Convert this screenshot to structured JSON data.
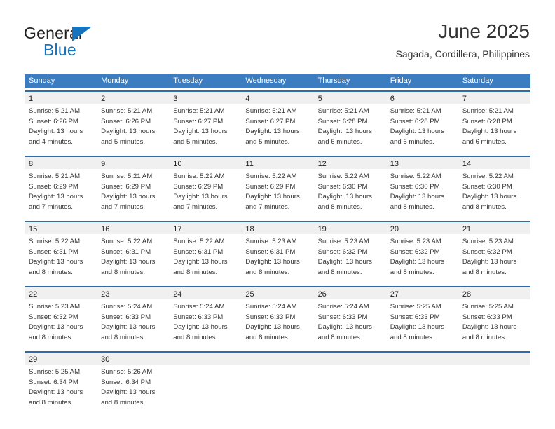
{
  "brand": {
    "name_top": "General",
    "name_bottom": "Blue",
    "accent_color": "#1574bd"
  },
  "header": {
    "title": "June 2025",
    "subtitle": "Sagada, Cordillera, Philippines"
  },
  "theme": {
    "header_row_bg": "#3b7dc0",
    "week_divider": "#2e6ca9",
    "day_band_bg": "#f0f0f0",
    "text_color": "#333333"
  },
  "weekday_headers": [
    "Sunday",
    "Monday",
    "Tuesday",
    "Wednesday",
    "Thursday",
    "Friday",
    "Saturday"
  ],
  "weeks": [
    {
      "days": [
        {
          "number": "1",
          "sunrise": "Sunrise: 5:21 AM",
          "sunset": "Sunset: 6:26 PM",
          "daylight_1": "Daylight: 13 hours",
          "daylight_2": "and 4 minutes."
        },
        {
          "number": "2",
          "sunrise": "Sunrise: 5:21 AM",
          "sunset": "Sunset: 6:26 PM",
          "daylight_1": "Daylight: 13 hours",
          "daylight_2": "and 5 minutes."
        },
        {
          "number": "3",
          "sunrise": "Sunrise: 5:21 AM",
          "sunset": "Sunset: 6:27 PM",
          "daylight_1": "Daylight: 13 hours",
          "daylight_2": "and 5 minutes."
        },
        {
          "number": "4",
          "sunrise": "Sunrise: 5:21 AM",
          "sunset": "Sunset: 6:27 PM",
          "daylight_1": "Daylight: 13 hours",
          "daylight_2": "and 5 minutes."
        },
        {
          "number": "5",
          "sunrise": "Sunrise: 5:21 AM",
          "sunset": "Sunset: 6:28 PM",
          "daylight_1": "Daylight: 13 hours",
          "daylight_2": "and 6 minutes."
        },
        {
          "number": "6",
          "sunrise": "Sunrise: 5:21 AM",
          "sunset": "Sunset: 6:28 PM",
          "daylight_1": "Daylight: 13 hours",
          "daylight_2": "and 6 minutes."
        },
        {
          "number": "7",
          "sunrise": "Sunrise: 5:21 AM",
          "sunset": "Sunset: 6:28 PM",
          "daylight_1": "Daylight: 13 hours",
          "daylight_2": "and 6 minutes."
        }
      ]
    },
    {
      "days": [
        {
          "number": "8",
          "sunrise": "Sunrise: 5:21 AM",
          "sunset": "Sunset: 6:29 PM",
          "daylight_1": "Daylight: 13 hours",
          "daylight_2": "and 7 minutes."
        },
        {
          "number": "9",
          "sunrise": "Sunrise: 5:21 AM",
          "sunset": "Sunset: 6:29 PM",
          "daylight_1": "Daylight: 13 hours",
          "daylight_2": "and 7 minutes."
        },
        {
          "number": "10",
          "sunrise": "Sunrise: 5:22 AM",
          "sunset": "Sunset: 6:29 PM",
          "daylight_1": "Daylight: 13 hours",
          "daylight_2": "and 7 minutes."
        },
        {
          "number": "11",
          "sunrise": "Sunrise: 5:22 AM",
          "sunset": "Sunset: 6:29 PM",
          "daylight_1": "Daylight: 13 hours",
          "daylight_2": "and 7 minutes."
        },
        {
          "number": "12",
          "sunrise": "Sunrise: 5:22 AM",
          "sunset": "Sunset: 6:30 PM",
          "daylight_1": "Daylight: 13 hours",
          "daylight_2": "and 8 minutes."
        },
        {
          "number": "13",
          "sunrise": "Sunrise: 5:22 AM",
          "sunset": "Sunset: 6:30 PM",
          "daylight_1": "Daylight: 13 hours",
          "daylight_2": "and 8 minutes."
        },
        {
          "number": "14",
          "sunrise": "Sunrise: 5:22 AM",
          "sunset": "Sunset: 6:30 PM",
          "daylight_1": "Daylight: 13 hours",
          "daylight_2": "and 8 minutes."
        }
      ]
    },
    {
      "days": [
        {
          "number": "15",
          "sunrise": "Sunrise: 5:22 AM",
          "sunset": "Sunset: 6:31 PM",
          "daylight_1": "Daylight: 13 hours",
          "daylight_2": "and 8 minutes."
        },
        {
          "number": "16",
          "sunrise": "Sunrise: 5:22 AM",
          "sunset": "Sunset: 6:31 PM",
          "daylight_1": "Daylight: 13 hours",
          "daylight_2": "and 8 minutes."
        },
        {
          "number": "17",
          "sunrise": "Sunrise: 5:22 AM",
          "sunset": "Sunset: 6:31 PM",
          "daylight_1": "Daylight: 13 hours",
          "daylight_2": "and 8 minutes."
        },
        {
          "number": "18",
          "sunrise": "Sunrise: 5:23 AM",
          "sunset": "Sunset: 6:31 PM",
          "daylight_1": "Daylight: 13 hours",
          "daylight_2": "and 8 minutes."
        },
        {
          "number": "19",
          "sunrise": "Sunrise: 5:23 AM",
          "sunset": "Sunset: 6:32 PM",
          "daylight_1": "Daylight: 13 hours",
          "daylight_2": "and 8 minutes."
        },
        {
          "number": "20",
          "sunrise": "Sunrise: 5:23 AM",
          "sunset": "Sunset: 6:32 PM",
          "daylight_1": "Daylight: 13 hours",
          "daylight_2": "and 8 minutes."
        },
        {
          "number": "21",
          "sunrise": "Sunrise: 5:23 AM",
          "sunset": "Sunset: 6:32 PM",
          "daylight_1": "Daylight: 13 hours",
          "daylight_2": "and 8 minutes."
        }
      ]
    },
    {
      "days": [
        {
          "number": "22",
          "sunrise": "Sunrise: 5:23 AM",
          "sunset": "Sunset: 6:32 PM",
          "daylight_1": "Daylight: 13 hours",
          "daylight_2": "and 8 minutes."
        },
        {
          "number": "23",
          "sunrise": "Sunrise: 5:24 AM",
          "sunset": "Sunset: 6:33 PM",
          "daylight_1": "Daylight: 13 hours",
          "daylight_2": "and 8 minutes."
        },
        {
          "number": "24",
          "sunrise": "Sunrise: 5:24 AM",
          "sunset": "Sunset: 6:33 PM",
          "daylight_1": "Daylight: 13 hours",
          "daylight_2": "and 8 minutes."
        },
        {
          "number": "25",
          "sunrise": "Sunrise: 5:24 AM",
          "sunset": "Sunset: 6:33 PM",
          "daylight_1": "Daylight: 13 hours",
          "daylight_2": "and 8 minutes."
        },
        {
          "number": "26",
          "sunrise": "Sunrise: 5:24 AM",
          "sunset": "Sunset: 6:33 PM",
          "daylight_1": "Daylight: 13 hours",
          "daylight_2": "and 8 minutes."
        },
        {
          "number": "27",
          "sunrise": "Sunrise: 5:25 AM",
          "sunset": "Sunset: 6:33 PM",
          "daylight_1": "Daylight: 13 hours",
          "daylight_2": "and 8 minutes."
        },
        {
          "number": "28",
          "sunrise": "Sunrise: 5:25 AM",
          "sunset": "Sunset: 6:33 PM",
          "daylight_1": "Daylight: 13 hours",
          "daylight_2": "and 8 minutes."
        }
      ]
    },
    {
      "days": [
        {
          "number": "29",
          "sunrise": "Sunrise: 5:25 AM",
          "sunset": "Sunset: 6:34 PM",
          "daylight_1": "Daylight: 13 hours",
          "daylight_2": "and 8 minutes."
        },
        {
          "number": "30",
          "sunrise": "Sunrise: 5:26 AM",
          "sunset": "Sunset: 6:34 PM",
          "daylight_1": "Daylight: 13 hours",
          "daylight_2": "and 8 minutes."
        },
        {
          "number": "",
          "sunrise": "",
          "sunset": "",
          "daylight_1": "",
          "daylight_2": ""
        },
        {
          "number": "",
          "sunrise": "",
          "sunset": "",
          "daylight_1": "",
          "daylight_2": ""
        },
        {
          "number": "",
          "sunrise": "",
          "sunset": "",
          "daylight_1": "",
          "daylight_2": ""
        },
        {
          "number": "",
          "sunrise": "",
          "sunset": "",
          "daylight_1": "",
          "daylight_2": ""
        },
        {
          "number": "",
          "sunrise": "",
          "sunset": "",
          "daylight_1": "",
          "daylight_2": ""
        }
      ]
    }
  ]
}
